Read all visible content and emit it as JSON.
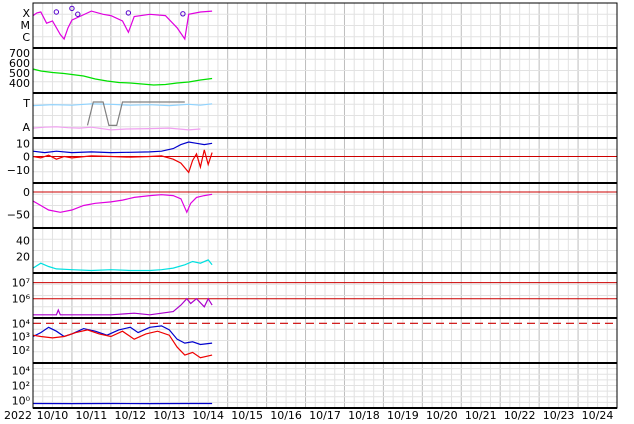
{
  "chart_data": {
    "type": "line",
    "x_tick_labels": [
      "10/10",
      "10/11",
      "10/12",
      "10/13",
      "10/14",
      "10/15",
      "10/16",
      "10/17",
      "10/18",
      "10/19",
      "10/20",
      "10/21",
      "10/22",
      "10/23",
      "10/24"
    ],
    "year_label": "2022",
    "x_range_days": [
      10.0,
      25.0
    ],
    "data_end_day": 14.6,
    "grid": true,
    "colors": {
      "magenta": "#e000e0",
      "green": "#00e000",
      "light_blue": "#8fd3ff",
      "pink": "#f0a0f0",
      "gray": "#808080",
      "blue": "#0000cc",
      "red": "#ee0000",
      "purple": "#aa00cc",
      "cyan": "#00e0e0"
    },
    "panels": [
      {
        "id": "xray-class",
        "tick_labels": [
          "X",
          "M",
          "C"
        ],
        "series": [
          {
            "color": "magenta",
            "points": [
              [
                10.0,
                0.72
              ],
              [
                10.1,
                0.78
              ],
              [
                10.2,
                0.8
              ],
              [
                10.35,
                0.55
              ],
              [
                10.5,
                0.6
              ],
              [
                10.7,
                0.3
              ],
              [
                10.8,
                0.2
              ],
              [
                10.9,
                0.45
              ],
              [
                11.0,
                0.62
              ],
              [
                11.2,
                0.7
              ],
              [
                11.5,
                0.82
              ],
              [
                11.8,
                0.75
              ],
              [
                12.0,
                0.72
              ],
              [
                12.3,
                0.6
              ],
              [
                12.45,
                0.35
              ],
              [
                12.6,
                0.7
              ],
              [
                13.0,
                0.75
              ],
              [
                13.4,
                0.72
              ],
              [
                13.7,
                0.45
              ],
              [
                13.9,
                0.2
              ],
              [
                14.0,
                0.75
              ],
              [
                14.3,
                0.8
              ],
              [
                14.6,
                0.82
              ]
            ]
          },
          {
            "color": "magenta",
            "markers": true,
            "points": [
              [
                10.6,
                0.2
              ],
              [
                11.0,
                0.12
              ],
              [
                11.15,
                0.25
              ],
              [
                12.45,
                0.22
              ],
              [
                13.85,
                0.24
              ]
            ]
          }
        ]
      },
      {
        "id": "solar-wind-speed",
        "tick_labels": [
          "700",
          "600",
          "500",
          "400"
        ],
        "ticks": [
          700,
          600,
          500,
          400
        ],
        "ylim": [
          300,
          750
        ],
        "series": [
          {
            "color": "green",
            "points": [
              [
                10.0,
                540
              ],
              [
                10.2,
                520
              ],
              [
                10.5,
                505
              ],
              [
                10.8,
                495
              ],
              [
                11.0,
                485
              ],
              [
                11.3,
                470
              ],
              [
                11.6,
                440
              ],
              [
                11.9,
                420
              ],
              [
                12.2,
                405
              ],
              [
                12.5,
                400
              ],
              [
                12.8,
                390
              ],
              [
                13.1,
                380
              ],
              [
                13.4,
                385
              ],
              [
                13.7,
                400
              ],
              [
                14.0,
                410
              ],
              [
                14.3,
                430
              ],
              [
                14.6,
                445
              ]
            ]
          }
        ]
      },
      {
        "id": "temperature-alpha",
        "tick_labels": [
          "T",
          "A"
        ],
        "series": [
          {
            "color": "light_blue",
            "points": [
              [
                10.0,
                0.72
              ],
              [
                10.5,
                0.74
              ],
              [
                11.0,
                0.73
              ],
              [
                11.5,
                0.76
              ],
              [
                12.0,
                0.75
              ],
              [
                12.5,
                0.73
              ],
              [
                13.0,
                0.74
              ],
              [
                13.5,
                0.72
              ],
              [
                14.0,
                0.75
              ],
              [
                14.3,
                0.73
              ],
              [
                14.6,
                0.76
              ]
            ]
          },
          {
            "color": "pink",
            "points": [
              [
                10.0,
                0.22
              ],
              [
                10.3,
                0.24
              ],
              [
                10.6,
                0.25
              ],
              [
                10.9,
                0.23
              ],
              [
                11.2,
                0.22
              ],
              [
                11.5,
                0.24
              ],
              [
                12.0,
                0.18
              ],
              [
                12.4,
                0.2
              ],
              [
                13.0,
                0.21
              ],
              [
                13.5,
                0.22
              ],
              [
                14.0,
                0.18
              ],
              [
                14.3,
                0.2
              ]
            ]
          },
          {
            "color": "gray",
            "points": [
              [
                11.4,
                0.28
              ],
              [
                11.55,
                0.8
              ],
              [
                11.8,
                0.8
              ],
              [
                11.95,
                0.28
              ],
              [
                12.15,
                0.28
              ],
              [
                12.3,
                0.8
              ],
              [
                13.9,
                0.8
              ]
            ]
          }
        ]
      },
      {
        "id": "magnetic-field",
        "tick_labels": [
          "10",
          "0",
          "−10"
        ],
        "ticks": [
          10,
          0,
          -10
        ],
        "ylim": [
          -20,
          14
        ],
        "ref_line": 0,
        "series": [
          {
            "color": "blue",
            "points": [
              [
                10.0,
                4
              ],
              [
                10.3,
                3
              ],
              [
                10.6,
                4
              ],
              [
                11.0,
                3
              ],
              [
                11.5,
                3.5
              ],
              [
                12.0,
                3
              ],
              [
                12.5,
                3.2
              ],
              [
                13.0,
                3.5
              ],
              [
                13.3,
                4
              ],
              [
                13.6,
                6
              ],
              [
                13.8,
                9
              ],
              [
                14.0,
                11
              ],
              [
                14.2,
                10
              ],
              [
                14.4,
                9
              ],
              [
                14.6,
                10
              ]
            ]
          },
          {
            "color": "red",
            "points": [
              [
                10.0,
                0
              ],
              [
                10.2,
                -1
              ],
              [
                10.4,
                1
              ],
              [
                10.6,
                -2
              ],
              [
                10.8,
                0
              ],
              [
                11.0,
                -1
              ],
              [
                11.5,
                0.5
              ],
              [
                12.0,
                0
              ],
              [
                12.5,
                -0.5
              ],
              [
                13.0,
                0
              ],
              [
                13.3,
                0.5
              ],
              [
                13.6,
                -2
              ],
              [
                13.8,
                -5
              ],
              [
                14.0,
                -12
              ],
              [
                14.1,
                -3
              ],
              [
                14.2,
                2
              ],
              [
                14.3,
                -8
              ],
              [
                14.4,
                5
              ],
              [
                14.5,
                -6
              ],
              [
                14.6,
                3
              ]
            ]
          }
        ]
      },
      {
        "id": "dst-index",
        "tick_labels": [
          "0",
          "−50"
        ],
        "ticks": [
          0,
          -50
        ],
        "ylim": [
          -80,
          20
        ],
        "ref_line": 0,
        "series": [
          {
            "color": "magenta",
            "points": [
              [
                10.0,
                -20
              ],
              [
                10.2,
                -30
              ],
              [
                10.4,
                -40
              ],
              [
                10.7,
                -45
              ],
              [
                11.0,
                -40
              ],
              [
                11.3,
                -30
              ],
              [
                11.6,
                -25
              ],
              [
                12.0,
                -22
              ],
              [
                12.3,
                -18
              ],
              [
                12.6,
                -12
              ],
              [
                13.0,
                -8
              ],
              [
                13.3,
                -6
              ],
              [
                13.6,
                -8
              ],
              [
                13.8,
                -15
              ],
              [
                13.95,
                -45
              ],
              [
                14.05,
                -25
              ],
              [
                14.2,
                -12
              ],
              [
                14.4,
                -8
              ],
              [
                14.6,
                -5
              ]
            ]
          }
        ]
      },
      {
        "id": "kp-index",
        "tick_labels": [
          "40",
          "20"
        ],
        "ticks": [
          40,
          20
        ],
        "ylim": [
          0,
          55
        ],
        "series": [
          {
            "color": "cyan",
            "points": [
              [
                10.0,
                6
              ],
              [
                10.2,
                12
              ],
              [
                10.4,
                8
              ],
              [
                10.6,
                5
              ],
              [
                11.0,
                4
              ],
              [
                11.5,
                3
              ],
              [
                12.0,
                4
              ],
              [
                12.5,
                3
              ],
              [
                13.0,
                3
              ],
              [
                13.3,
                4
              ],
              [
                13.6,
                6
              ],
              [
                13.9,
                10
              ],
              [
                14.1,
                14
              ],
              [
                14.3,
                12
              ],
              [
                14.5,
                16
              ],
              [
                14.6,
                10
              ]
            ]
          }
        ]
      },
      {
        "id": "electron-flux",
        "tick_labels": [
          "10⁷",
          "10⁶"
        ],
        "tick_values": [
          7,
          6
        ],
        "log": true,
        "ylim": [
          4.8,
          7.6
        ],
        "ref_lines": [
          7,
          6
        ],
        "series": [
          {
            "color": "purple",
            "points": [
              [
                10.0,
                5.0
              ],
              [
                10.6,
                5.0
              ],
              [
                10.65,
                5.3
              ],
              [
                10.7,
                5.0
              ],
              [
                12.0,
                5.0
              ],
              [
                12.6,
                5.1
              ],
              [
                13.0,
                5.0
              ],
              [
                13.6,
                5.2
              ],
              [
                13.8,
                5.6
              ],
              [
                13.95,
                6.0
              ],
              [
                14.05,
                5.7
              ],
              [
                14.2,
                6.0
              ],
              [
                14.4,
                5.5
              ],
              [
                14.5,
                6.0
              ],
              [
                14.6,
                5.6
              ]
            ]
          }
        ]
      },
      {
        "id": "proton-flux",
        "tick_labels": [
          "10⁴",
          "10³",
          "10²"
        ],
        "tick_values": [
          4,
          3,
          2
        ],
        "log": true,
        "ylim": [
          1,
          4.4
        ],
        "dashed_ref": 4,
        "series": [
          {
            "color": "blue",
            "points": [
              [
                10.0,
                3.0
              ],
              [
                10.2,
                3.3
              ],
              [
                10.4,
                3.7
              ],
              [
                10.6,
                3.4
              ],
              [
                10.8,
                3.0
              ],
              [
                11.0,
                3.2
              ],
              [
                11.3,
                3.6
              ],
              [
                11.6,
                3.4
              ],
              [
                11.9,
                3.1
              ],
              [
                12.2,
                3.5
              ],
              [
                12.5,
                3.7
              ],
              [
                12.7,
                3.3
              ],
              [
                13.0,
                3.7
              ],
              [
                13.3,
                3.8
              ],
              [
                13.5,
                3.5
              ],
              [
                13.7,
                2.8
              ],
              [
                13.9,
                2.5
              ],
              [
                14.1,
                2.6
              ],
              [
                14.3,
                2.4
              ],
              [
                14.6,
                2.5
              ]
            ]
          },
          {
            "color": "red",
            "points": [
              [
                10.0,
                3.1
              ],
              [
                10.2,
                3.0
              ],
              [
                10.5,
                2.9
              ],
              [
                10.8,
                3.0
              ],
              [
                11.1,
                3.3
              ],
              [
                11.4,
                3.5
              ],
              [
                11.7,
                3.2
              ],
              [
                12.0,
                3.0
              ],
              [
                12.3,
                3.4
              ],
              [
                12.6,
                2.8
              ],
              [
                12.9,
                3.2
              ],
              [
                13.2,
                3.4
              ],
              [
                13.5,
                3.1
              ],
              [
                13.7,
                2.2
              ],
              [
                13.9,
                1.6
              ],
              [
                14.1,
                1.8
              ],
              [
                14.3,
                1.4
              ],
              [
                14.6,
                1.6
              ]
            ]
          }
        ]
      },
      {
        "id": "neutron-count",
        "tick_labels": [
          "10⁴",
          "10²",
          "10⁰"
        ],
        "tick_values": [
          4,
          2,
          0
        ],
        "log": true,
        "ylim": [
          -1,
          5
        ],
        "series": [
          {
            "color": "blue",
            "points": [
              [
                10.0,
                -0.4
              ],
              [
                11.0,
                -0.42
              ],
              [
                12.0,
                -0.4
              ],
              [
                13.0,
                -0.41
              ],
              [
                14.0,
                -0.4
              ],
              [
                14.6,
                -0.4
              ]
            ]
          }
        ]
      }
    ]
  }
}
